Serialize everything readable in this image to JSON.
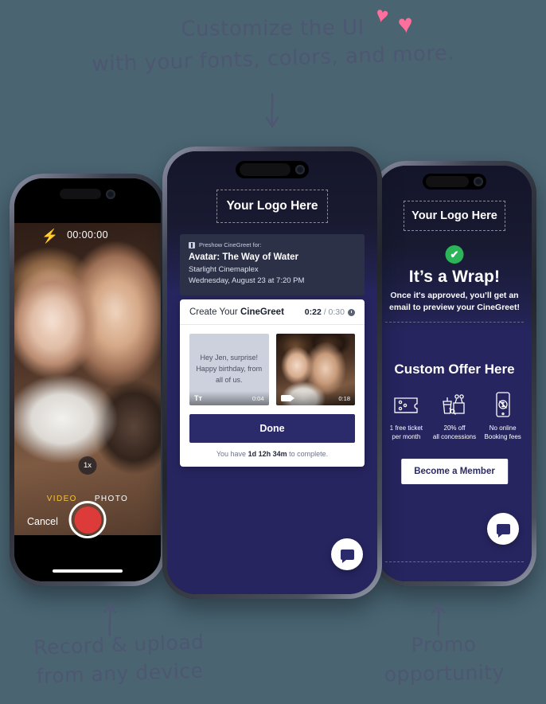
{
  "annotations": {
    "headline_line1": "Customize the UI",
    "headline_line2": "with your fonts, colors, and more.",
    "heart_glyph": "♥",
    "caption_left_line1": "Record & upload",
    "caption_left_line2": "from any device",
    "caption_right_line1": "Promo",
    "caption_right_line2": "opportunity",
    "arrow_down_name": "arrow-down-icon",
    "arrow_up_name": "arrow-up-icon",
    "ink_color": "#4e5671",
    "heart_color": "#fd6f9c"
  },
  "page": {
    "background_color": "#4a6472"
  },
  "camera_phone": {
    "flash_icon": "⚡",
    "timer": "00:00:00",
    "zoom_level": "1x",
    "modes": [
      {
        "label": "VIDEO",
        "selected": true,
        "color": "#f5c33b"
      },
      {
        "label": "PHOTO",
        "selected": false,
        "color": "#ffffff"
      }
    ],
    "cancel_label": "Cancel",
    "shutter_color": "#dd3a3a"
  },
  "create_phone": {
    "logo_placeholder": "Your Logo Here",
    "preshow": {
      "eyebrow": "Preshow CineGreet for:",
      "movie_title": "Avatar: The Way of Water",
      "venue": "Starlight Cinemaplex",
      "showtime": "Wednesday, August 23 at 7:20 PM"
    },
    "greet_card": {
      "title_prefix": "Create Your ",
      "title_brand": "CineGreet",
      "elapsed": "0:22",
      "total": " / 0:30",
      "clips": [
        {
          "kind": "text",
          "message": "Hey Jen, surprise! Happy birthday, from all of us.",
          "badge_icon": "Tᴛ",
          "duration": "0:04"
        },
        {
          "kind": "video",
          "badge_icon": "video-camera",
          "duration": "0:18"
        }
      ],
      "done_label": "Done",
      "deadline_prefix": "You have ",
      "deadline_value": "1d 12h 34m",
      "deadline_suffix": " to complete."
    },
    "chat_fab_icon": "chat-bubble",
    "background_color": "#272560",
    "accent_color": "#2b2a6b"
  },
  "wrap_phone": {
    "logo_placeholder": "Your Logo Here",
    "check_icon": "✔",
    "check_color": "#2bb558",
    "title": "It’s a Wrap!",
    "subtitle": "Once it's approved, you’ll get an email to preview your CineGreet!",
    "offer_title": "Custom Offer Here",
    "perks": [
      {
        "icon": "ticket-icon",
        "label_line1": "1 free ticket",
        "label_line2": "per month"
      },
      {
        "icon": "concessions-icon",
        "label_line1": "20% off",
        "label_line2": "all concessions"
      },
      {
        "icon": "no-fees-phone-icon",
        "label_line1": "No online",
        "label_line2": "Booking fees"
      }
    ],
    "member_button": "Become a Member",
    "chat_fab_icon": "chat-bubble",
    "background_color": "#272560"
  }
}
